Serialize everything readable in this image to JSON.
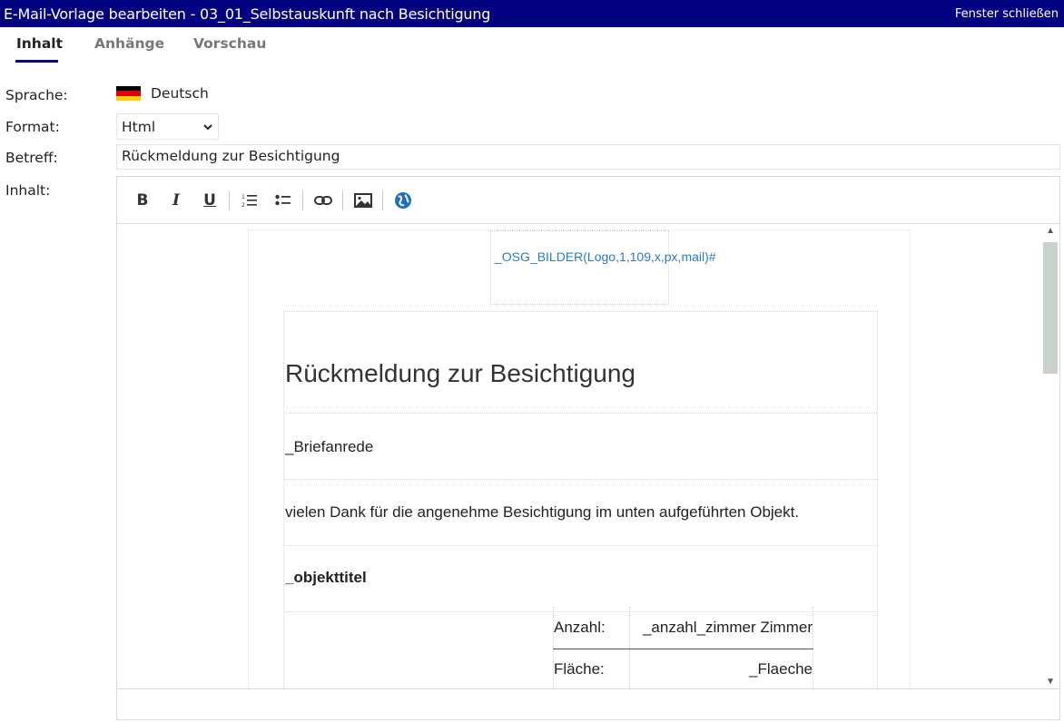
{
  "window": {
    "title": "E-Mail-Vorlage bearbeiten - 03_01_Selbstauskunft nach Besichtigung",
    "close_label": "Fenster schließen"
  },
  "tabs": [
    {
      "label": "Inhalt",
      "active": true
    },
    {
      "label": "Anhänge",
      "active": false
    },
    {
      "label": "Vorschau",
      "active": false
    }
  ],
  "form": {
    "language_label": "Sprache:",
    "language_value": "Deutsch",
    "format_label": "Format:",
    "format_value": "Html",
    "subject_label": "Betreff:",
    "subject_value": "Rückmeldung zur Besichtigung",
    "content_label": "Inhalt:"
  },
  "toolbar": {
    "buttons": [
      "bold-icon",
      "italic-icon",
      "underline-icon",
      "ordered-list-icon",
      "bullet-list-icon",
      "link-icon",
      "image-icon",
      "globe-icon"
    ]
  },
  "editor_content": {
    "logo_placeholder": "_OSG_BILDER(Logo,1,109,x,px,mail)#",
    "heading": "Rückmeldung zur Besichtigung",
    "salutation": "_Briefanrede",
    "body": "vielen Dank für die angenehme Besichtigung im unten aufgeführten Objekt.",
    "object_title": "_objekttitel",
    "table": [
      {
        "label": "Anzahl:",
        "value": "_anzahl_zimmer Zimmer"
      },
      {
        "label": "Fläche:",
        "value": "_Flaeche"
      }
    ]
  },
  "colors": {
    "titlebar": "#030280",
    "link": "#2b7bc1",
    "scroll_thumb": "#c9d2c9"
  }
}
